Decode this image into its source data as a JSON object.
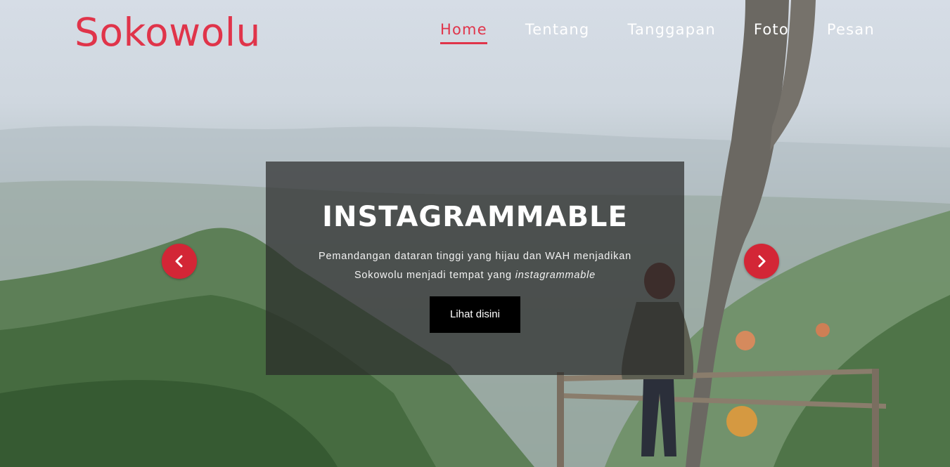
{
  "brand": {
    "name": "Sokowolu",
    "accent_color": "#e0344a"
  },
  "nav": {
    "items": [
      {
        "label": "Home",
        "active": true
      },
      {
        "label": "Tentang",
        "active": false
      },
      {
        "label": "Tanggapan",
        "active": false
      },
      {
        "label": "Foto",
        "active": false
      },
      {
        "label": "Pesan",
        "active": false
      }
    ]
  },
  "slide": {
    "title": "INSTAGRAMMABLE",
    "description_part1": "Pemandangan dataran tinggi yang hijau dan WAH menjadikan",
    "description_part2": "Sokowolu menjadi tempat yang",
    "description_emphasis": "instagrammable",
    "button_label": "Lihat disini"
  },
  "carousel": {
    "prev_icon": "chevron-left-icon",
    "next_icon": "chevron-right-icon",
    "arrow_color": "#d32636"
  }
}
